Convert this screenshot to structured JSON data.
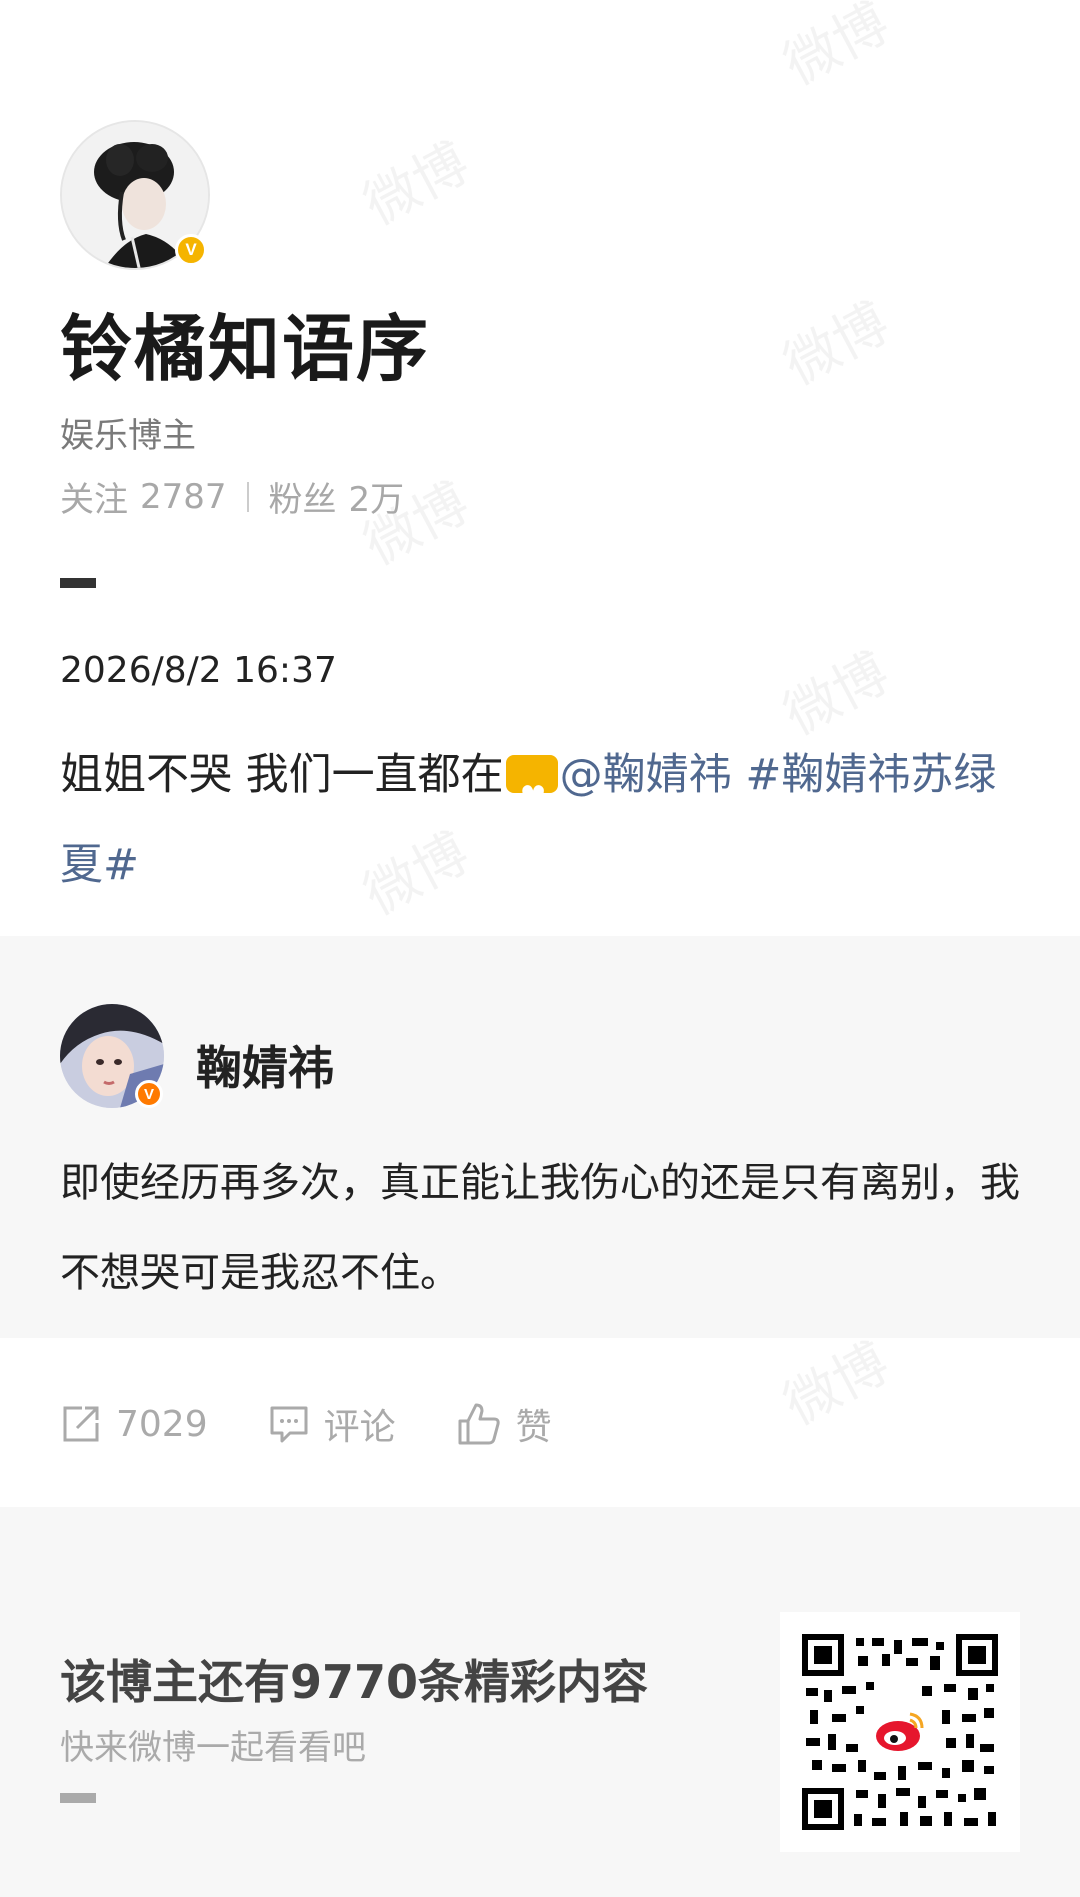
{
  "watermark": {
    "text": "微博"
  },
  "profile": {
    "name": "铃橘知语序",
    "role": "娱乐博主",
    "following_label": "关注",
    "following_count": "2787",
    "followers_label": "粉丝",
    "followers_count": "2万"
  },
  "post": {
    "timestamp": "2026/8/2 16:37",
    "text": "姐姐不哭 我们一直都在",
    "mention": "@鞠婧祎",
    "hashtag": "#鞠婧祎苏绿夏#"
  },
  "repost": {
    "author": "鞠婧祎",
    "text": "即使经历再多次，真正能让我伤心的还是只有离别，我不想哭可是我忍不住。"
  },
  "actions": {
    "share_count": "7029",
    "comment_label": "评论",
    "like_label": "赞"
  },
  "footer": {
    "title": "该博主还有9770条精彩内容",
    "subtitle": "快来微博一起看看吧"
  },
  "colors": {
    "link": "#50688f",
    "verified_gold": "#f5b400",
    "verified_orange": "#ff7a00",
    "background_panel": "#f7f7f7"
  },
  "icons": [
    "verified-badge-icon",
    "share-icon",
    "comment-icon",
    "like-icon",
    "weibo-logo-icon",
    "qr-code"
  ]
}
